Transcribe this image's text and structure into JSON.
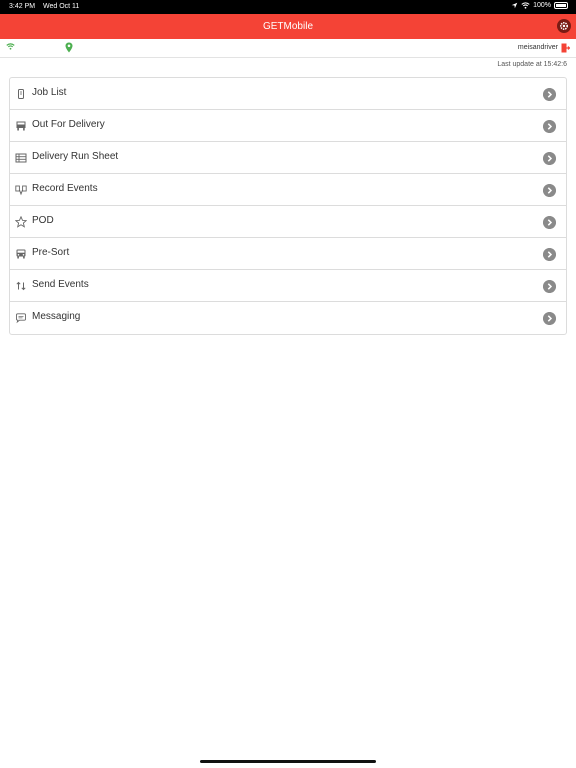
{
  "status_bar": {
    "time": "3:42 PM",
    "date": "Wed Oct 11",
    "battery": "100%"
  },
  "header": {
    "title": "GETMobile"
  },
  "info_bar": {
    "username": "meisandriver"
  },
  "last_update": "Last update at 15:42:6",
  "menu": {
    "items": [
      {
        "label": "Job List",
        "icon": "job-list-icon"
      },
      {
        "label": "Out For Delivery",
        "icon": "truck-icon"
      },
      {
        "label": "Delivery Run Sheet",
        "icon": "run-sheet-icon"
      },
      {
        "label": "Record Events",
        "icon": "record-events-icon"
      },
      {
        "label": "POD",
        "icon": "star-icon"
      },
      {
        "label": "Pre-Sort",
        "icon": "bus-icon"
      },
      {
        "label": "Send Events",
        "icon": "send-events-icon"
      },
      {
        "label": "Messaging",
        "icon": "message-icon"
      }
    ]
  },
  "colors": {
    "accent": "#f44336",
    "gear_bg": "#7a1b14",
    "chevron": "#8a8a8a",
    "status_green": "#4caf50"
  }
}
